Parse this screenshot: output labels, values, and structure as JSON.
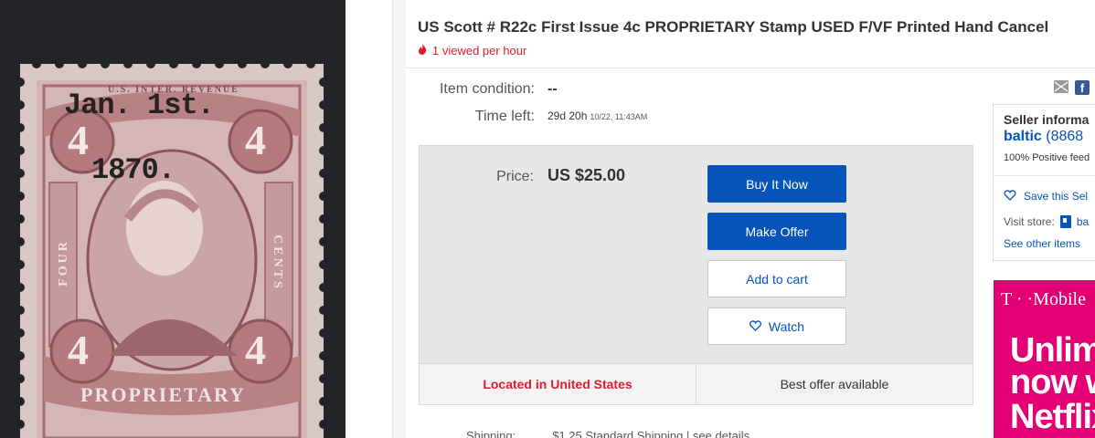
{
  "listing": {
    "title": "US Scott # R22c First Issue 4c PROPRIETARY Stamp USED F/VF Printed Hand Cancel",
    "hot_text": "1 viewed per hour",
    "hot_icon": "flame-icon"
  },
  "stamp": {
    "overprint_line1": "Jan. 1st.",
    "overprint_line2": "1870.",
    "denomination": "4",
    "side_left": "FOUR",
    "side_right": "CENTS",
    "bottom_text": "PROPRIETARY",
    "top_text": "U.S. INTER. REVENUE",
    "color": "#b5868a"
  },
  "details": {
    "condition_label": "Item condition:",
    "condition_value": "--",
    "time_left_label": "Time left:",
    "time_left_value": "29d 20h",
    "time_left_end": "10/22, 11:43AM"
  },
  "buybox": {
    "price_label": "Price:",
    "price_value": "US $25.00",
    "buy_now": "Buy It Now",
    "make_offer": "Make Offer",
    "add_to_cart": "Add to cart",
    "watch": "Watch",
    "location": "Located in United States",
    "best_offer": "Best offer available"
  },
  "shipping": {
    "label": "Shipping:",
    "value": "$1.25  Standard Shipping | see details"
  },
  "share": {
    "mail_icon": "mail-icon",
    "facebook_icon": "facebook-icon",
    "facebook_glyph": "f"
  },
  "seller": {
    "title": "Seller informa",
    "name": "baltic",
    "count": "(8868",
    "positive": "100% Positive feed",
    "save": "Save this Sel",
    "visit_store": "Visit store:",
    "store_link": "ba",
    "see_other": "See other items"
  },
  "ad": {
    "brand": "T · ·Mobile",
    "line1": "Unlim",
    "line2": "now w",
    "line3": "Netflix"
  },
  "colors": {
    "ebay_blue": "#0654ba",
    "alert_red": "#dd1e31",
    "tmobile_magenta": "#e20074"
  }
}
